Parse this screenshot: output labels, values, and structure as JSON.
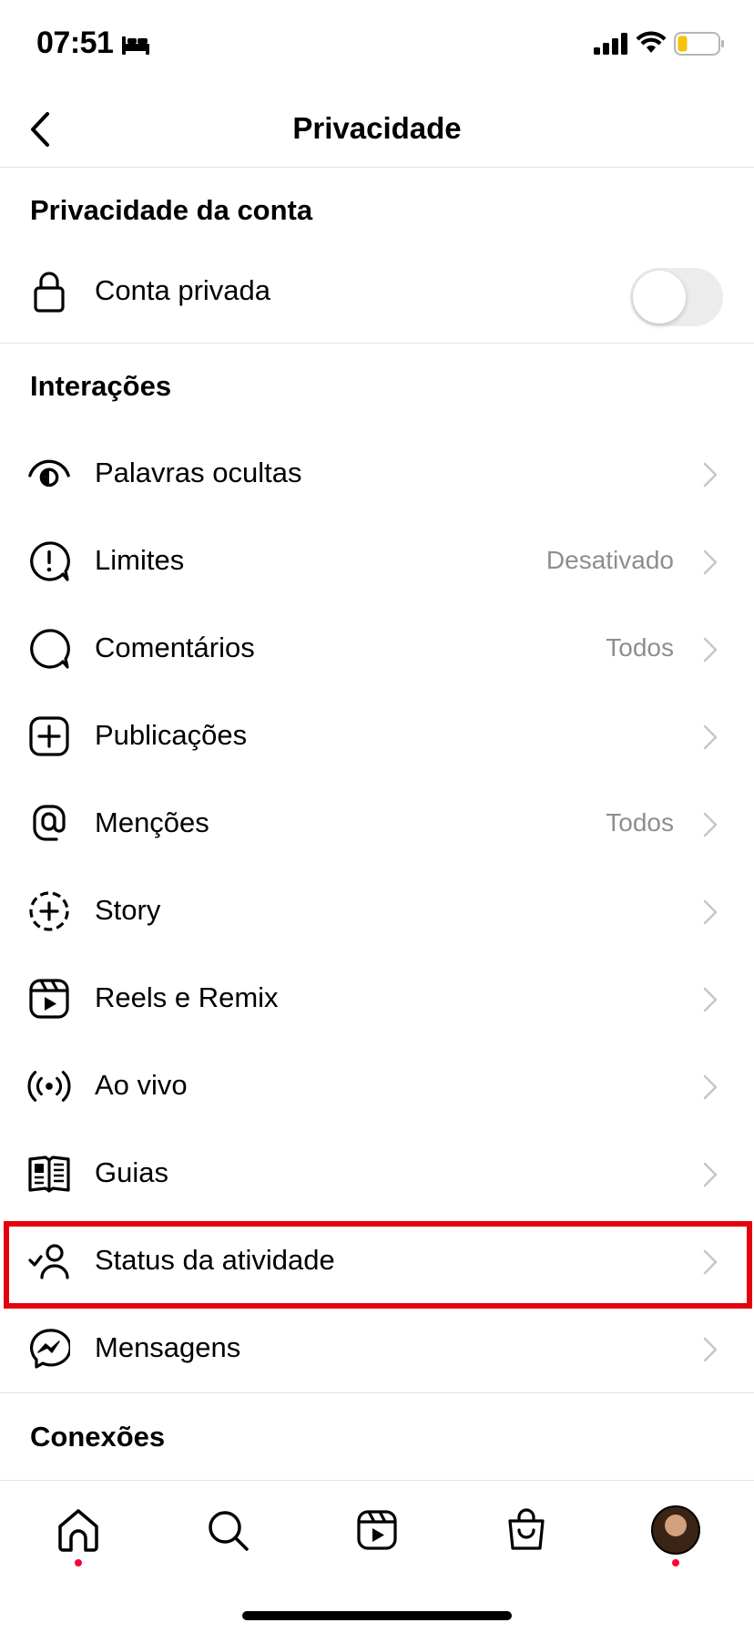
{
  "status_bar": {
    "time": "07:51"
  },
  "header": {
    "title": "Privacidade"
  },
  "account_section": {
    "title": "Privacidade da conta",
    "private_account": {
      "label": "Conta privada",
      "enabled": false
    }
  },
  "interactions_section": {
    "title": "Interações",
    "items": [
      {
        "label": "Palavras ocultas",
        "value": "",
        "icon": "eye-icon"
      },
      {
        "label": "Limites",
        "value": "Desativado",
        "icon": "limits-icon"
      },
      {
        "label": "Comentários",
        "value": "Todos",
        "icon": "comment-icon"
      },
      {
        "label": "Publicações",
        "value": "",
        "icon": "add-post-icon"
      },
      {
        "label": "Menções",
        "value": "Todos",
        "icon": "at-icon"
      },
      {
        "label": "Story",
        "value": "",
        "icon": "story-add-icon"
      },
      {
        "label": "Reels e Remix",
        "value": "",
        "icon": "reels-icon"
      },
      {
        "label": "Ao vivo",
        "value": "",
        "icon": "live-icon"
      },
      {
        "label": "Guias",
        "value": "",
        "icon": "guides-icon"
      },
      {
        "label": "Status da atividade",
        "value": "",
        "icon": "activity-status-icon"
      },
      {
        "label": "Mensagens",
        "value": "",
        "icon": "messenger-icon"
      }
    ]
  },
  "connections_section": {
    "title": "Conexões"
  },
  "tab_bar": {
    "tabs": [
      "home",
      "search",
      "reels",
      "shop",
      "profile"
    ]
  },
  "colors": {
    "highlight": "#e3000f",
    "notification_dot": "#ff0037",
    "secondary_text": "#8e8e8e"
  }
}
